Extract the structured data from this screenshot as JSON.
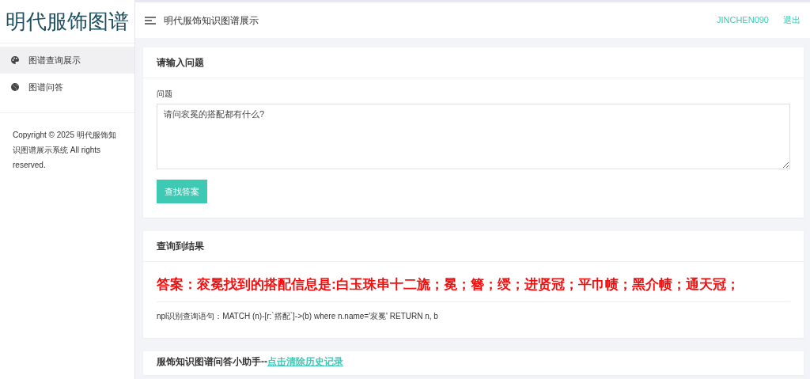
{
  "sidebar": {
    "logo": "明代服饰图谱",
    "items": [
      {
        "label": "图谱查询展示",
        "selected": true
      },
      {
        "label": "图谱问答",
        "selected": false
      }
    ],
    "copyright": "Copyright © 2025 明代服饰知识图谱展示系统 All rights reserved."
  },
  "topbar": {
    "title": "明代服饰知识图谱展示",
    "user": "JINCHEN090",
    "logout": "退出"
  },
  "question_card": {
    "title": "请输入问题",
    "field_label": "问题",
    "value": "请问衮冕的搭配都有什么?",
    "button": "查找答案"
  },
  "result_card": {
    "title": "查询到结果",
    "answer": "答案：衮冕找到的搭配信息是:白玉珠串十二旒；冕；簪；绶；进贤冠；平巾帻；黑介帻；通天冠；",
    "query": "npl识别查询语句：MATCH (n)-[r:`搭配`]->(b) where n.name='衮冕' RETURN n, b"
  },
  "assistant_card": {
    "title": "服饰知识图谱问答小助手--",
    "link": "点击清除历史记录"
  }
}
